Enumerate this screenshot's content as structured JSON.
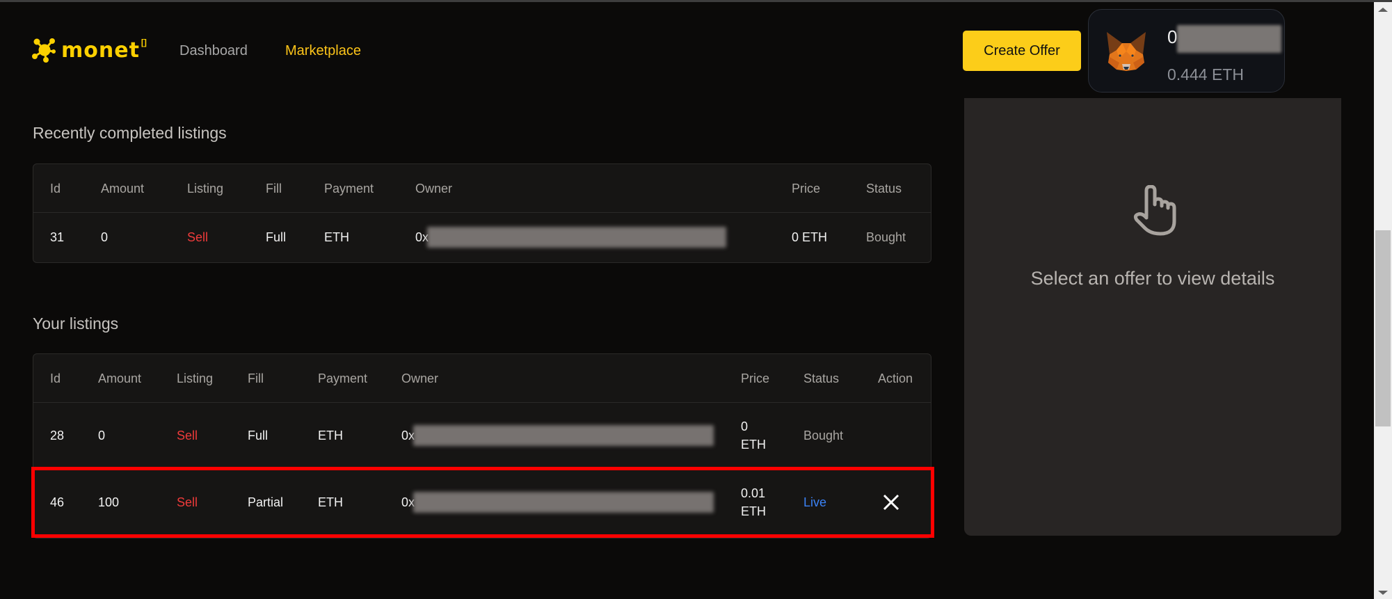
{
  "brand": {
    "name": "monet",
    "superscript": "[]",
    "accent": "#fcd000"
  },
  "nav": {
    "items": [
      {
        "label": "Dashboard",
        "active": false
      },
      {
        "label": "Marketplace",
        "active": true
      }
    ]
  },
  "header": {
    "create_offer_label": "Create Offer",
    "wallet": {
      "address_prefix": "0",
      "balance": "0.444 ETH",
      "icon": "metamask-fox-icon"
    }
  },
  "recent": {
    "title": "Recently completed listings",
    "columns": [
      "Id",
      "Amount",
      "Listing",
      "Fill",
      "Payment",
      "Owner",
      "Price",
      "Status"
    ],
    "rows": [
      {
        "id": "31",
        "amount": "0",
        "listing": "Sell",
        "fill": "Full",
        "payment": "ETH",
        "owner_prefix": "0x",
        "price": "0 ETH",
        "status": "Bought"
      }
    ]
  },
  "yours": {
    "title": "Your listings",
    "columns": [
      "Id",
      "Amount",
      "Listing",
      "Fill",
      "Payment",
      "Owner",
      "Price",
      "Status",
      "Action"
    ],
    "rows": [
      {
        "id": "28",
        "amount": "0",
        "listing": "Sell",
        "fill": "Full",
        "payment": "ETH",
        "owner_prefix": "0x",
        "price_value": "0",
        "price_unit": "ETH",
        "status": "Bought",
        "action": ""
      },
      {
        "id": "46",
        "amount": "100",
        "listing": "Sell",
        "fill": "Partial",
        "payment": "ETH",
        "owner_prefix": "0x",
        "price_value": "0.01",
        "price_unit": "ETH",
        "status": "Live",
        "action": "cancel"
      }
    ]
  },
  "details": {
    "empty_text": "Select an offer to view details",
    "icon": "pointer-hand-icon"
  },
  "colors": {
    "sell": "#ef3b3b",
    "live": "#3b82f6",
    "highlight": "#ff0000",
    "button": "#fccd19"
  }
}
